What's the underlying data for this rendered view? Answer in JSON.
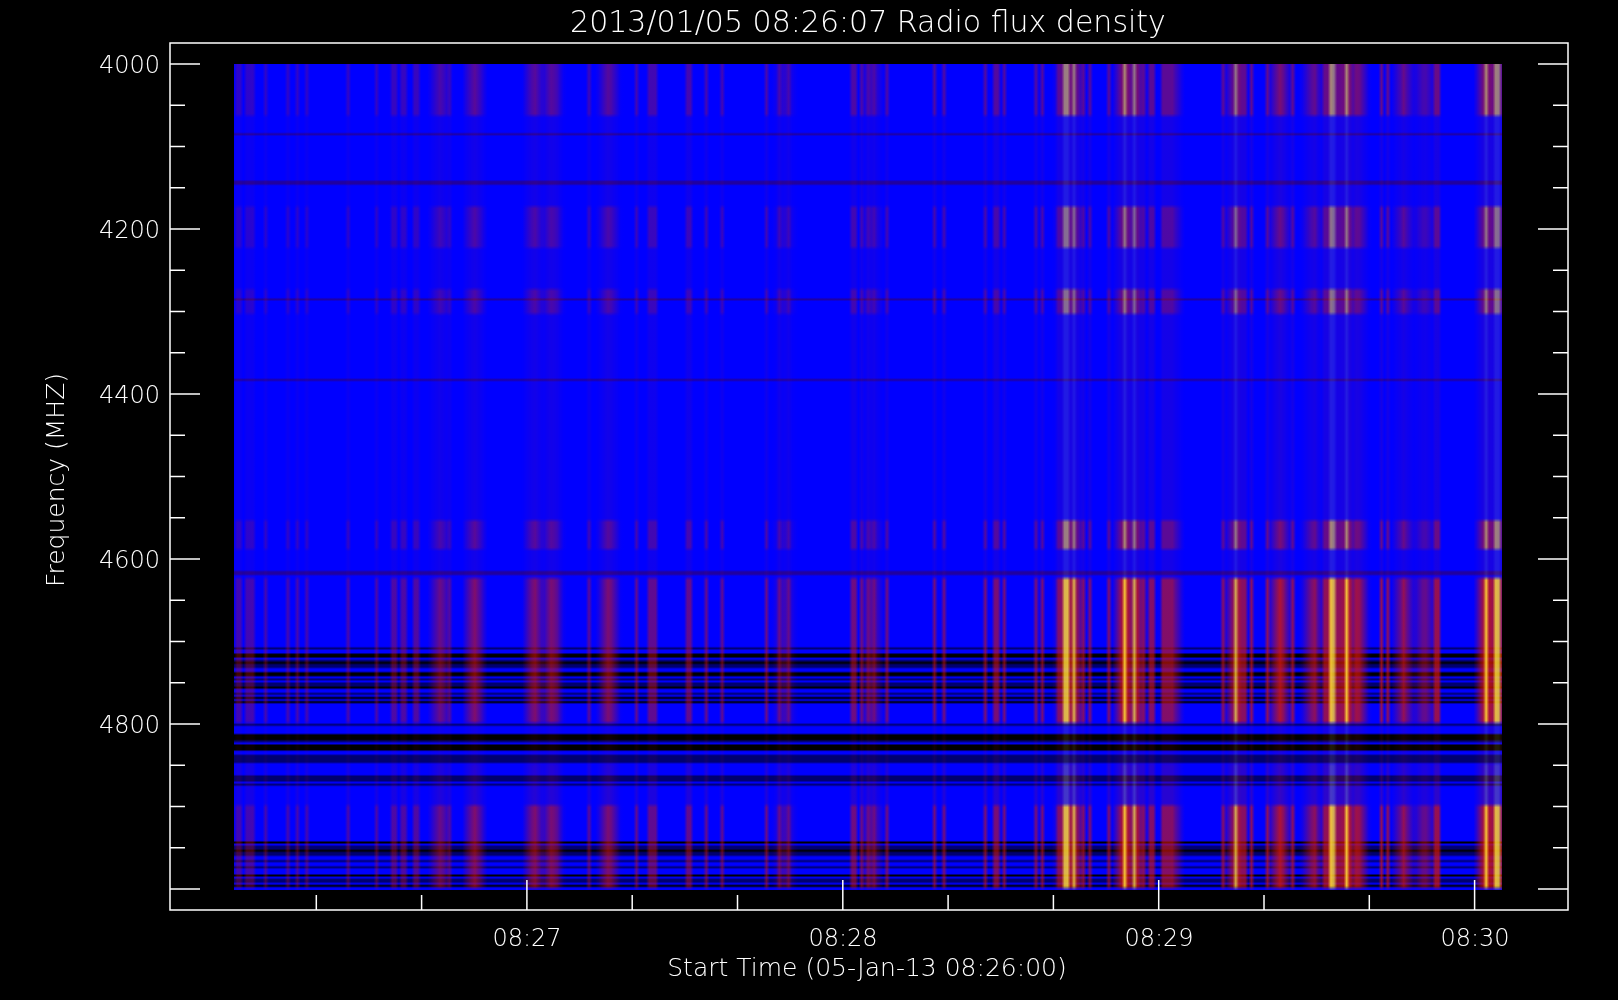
{
  "title": "2013/01/05 08:26:07 Radio flux density",
  "y_axis": {
    "label": "Frequency (MHZ)",
    "ticks": [
      "4000",
      "4200",
      "4400",
      "4600",
      "4800"
    ]
  },
  "x_axis": {
    "label": "Start Time (05-Jan-13 08:26:00)",
    "ticks": [
      "08:27",
      "08:28",
      "08:29",
      "08:30"
    ]
  }
}
